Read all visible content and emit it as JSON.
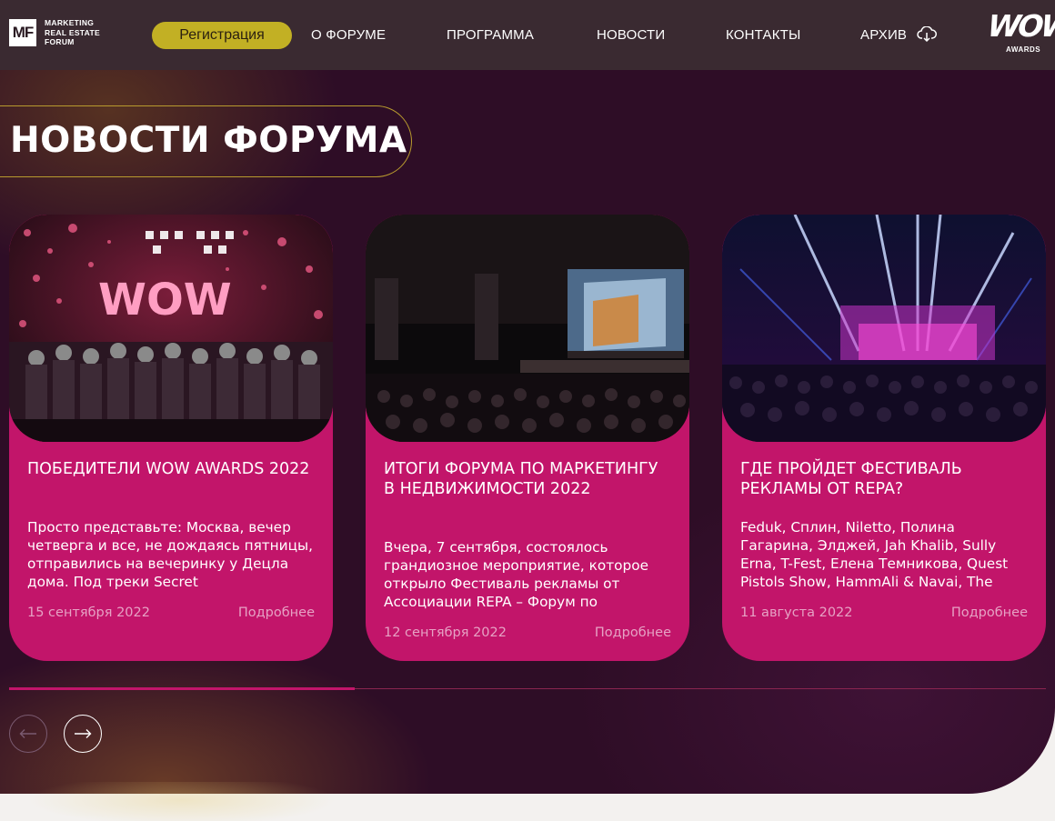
{
  "header": {
    "logo_mark": "MF",
    "logo_lines": [
      "MARKETING",
      "REAL ESTATE",
      "FORUM"
    ],
    "register_label": "Регистрация",
    "nav": [
      {
        "label": "О ФОРУМЕ"
      },
      {
        "label": "ПРОГРАММА"
      },
      {
        "label": "НОВОСТИ"
      },
      {
        "label": "КОНТАКТЫ"
      },
      {
        "label": "АРХИВ"
      }
    ],
    "archive_icon": "cloud-download-icon",
    "partner_logo": {
      "word": "WOW",
      "sub": "AWARDS"
    }
  },
  "section": {
    "title": "НОВОСТИ ФОРУМА"
  },
  "cards": [
    {
      "title": "ПОБЕДИТЕЛИ WOW AWARDS 2022",
      "text": "Просто представьте: Москва, вечер четверга и все, не дождаясь пятницы, отправились на вечеринку у Децла дома. Под треки Secret",
      "date": "15 сентября 2022",
      "more": "Подробнее",
      "image_text": "WOW"
    },
    {
      "title": "ИТОГИ ФОРУМА ПО МАРКЕТИНГУ В НЕДВИЖИМОСТИ 2022",
      "text": "Вчера, 7 сентября, состоялось грандиозное мероприятие, которое открыло Фестиваль рекламы от Ассоциации REPA – Форум по",
      "date": "12 сентября 2022",
      "more": "Подробнее"
    },
    {
      "title": "ГДЕ ПРОЙДЕТ ФЕСТИВАЛЬ РЕКЛАМЫ ОТ REPA?",
      "text": "Feduk, Сплин, Niletto, Полина Гагарина, Элджей, Jah Khalib, Sully Erna, T-Fest, Елена Темникова, Quest Pistols Show, HammAli & Navai, The",
      "date": "11 августа 2022",
      "more": "Подробнее"
    }
  ],
  "slider": {
    "progress": 0.333,
    "prev_icon": "arrow-left-icon",
    "next_icon": "arrow-right-icon"
  },
  "colors": {
    "accent": "#c2b024",
    "card": "#c2156a",
    "background": "#2e0d26",
    "header": "#3a2a31"
  }
}
